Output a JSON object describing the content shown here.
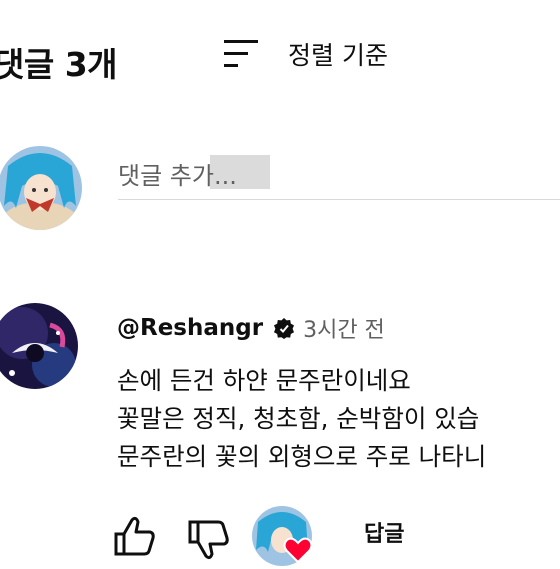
{
  "header": {
    "title": "댓글 3개",
    "sort_label": "정렬 기준"
  },
  "composer": {
    "placeholder": "댓글 추가..."
  },
  "comment": {
    "author": "@Reshangr",
    "time": "3시간 전",
    "lines": [
      "손에 든건 하얀 문주란이네요",
      "꽃말은 정직, 청초함, 순박함이 있습",
      "문주란의 꽃의 외형으로 주로 나타니"
    ],
    "reply_label": "답글"
  },
  "icons": {
    "sort": "sort-icon",
    "verified": "verified-icon",
    "like": "thumb-up-icon",
    "dislike": "thumb-down-icon",
    "heart": "heart-icon"
  },
  "colors": {
    "heart": "#ff0033",
    "secondary_text": "#606060",
    "divider": "#d9d9d9"
  }
}
